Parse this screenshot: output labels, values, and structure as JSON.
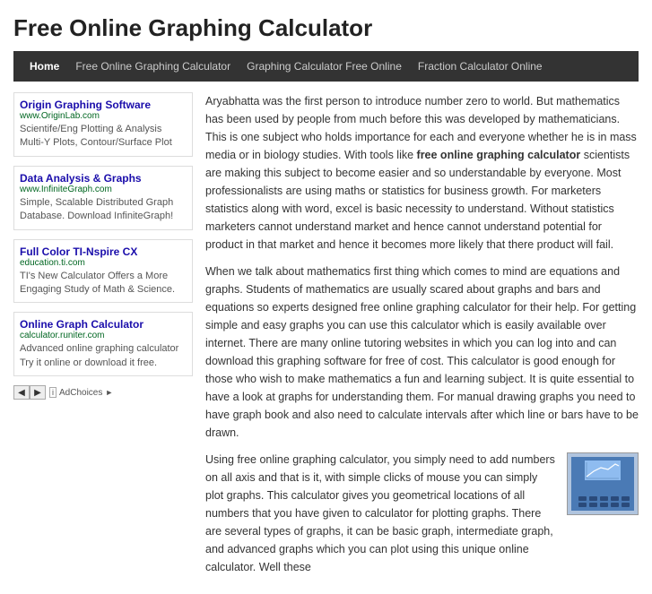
{
  "page": {
    "title": "Free Online Graphing Calculator"
  },
  "nav": {
    "items": [
      {
        "label": "Home",
        "active": true
      },
      {
        "label": "Free Online Graphing Calculator",
        "active": false
      },
      {
        "label": "Graphing Calculator Free Online",
        "active": false
      },
      {
        "label": "Fraction Calculator Online",
        "active": false
      }
    ]
  },
  "sidebar": {
    "ads": [
      {
        "title": "Origin Graphing Software",
        "url": "www.OriginLab.com",
        "description": "Scientife/Eng Plotting & Analysis Multi-Y Plots, Contour/Surface Plot"
      },
      {
        "title": "Data Analysis & Graphs",
        "url": "www.InfiniteGraph.com",
        "description": "Simple, Scalable Distributed Graph Database. Download InfiniteGraph!"
      },
      {
        "title": "Full Color TI-Nspire CX",
        "url": "education.ti.com",
        "description": "TI's New Calculator Offers a More Engaging Study of Math & Science."
      },
      {
        "title": "Online Graph Calculator",
        "url": "calculator.runiter.com",
        "description": "Advanced online graphing calculator Try it online or download it free."
      }
    ],
    "adchoices_label": "AdChoices"
  },
  "content": {
    "paragraph1": "Aryabhatta was the first person to introduce number zero to world. But mathematics has been used by people from much before this was developed by mathematicians. This is one subject who holds importance for each and everyone whether he is in mass media or in biology studies. With tools like ",
    "paragraph1_bold": "free online graphing calculator",
    "paragraph1_cont": " scientists are making this subject to become easier and so understandable by everyone. Most professionalists are using maths or statistics for business growth. For marketers statistics along with word, excel is basic necessity to understand. Without statistics marketers cannot understand market and hence cannot understand potential for product in that market and hence it becomes more likely that there product will fail.",
    "paragraph2_start": "When we talk about mathematics first thing which comes to mind are equations and graphs. Students of mathematics are usually scared about graphs and bars and equations so experts designed ",
    "paragraph2_bold": "free online graphing calculator",
    "paragraph2_cont": " for their help. For getting simple and easy graphs you can use this calculator which is easily available over internet. There are many online tutoring websites in which you can log into and can download this graphing software for free of cost. This calculator is good enough for those who wish to make mathematics a fun and learning subject. It is quite essential to have a look at graphs for understanding them. For manual drawing graphs you need to have graph book and also need to calculate intervals after which line or bars have to be drawn.",
    "paragraph3_start": "Using ",
    "paragraph3_bold": "free online graphing calculator,",
    "paragraph3_cont": " you simply need to add numbers on all axis and that is it, with simple clicks of mouse you can simply plot graphs. This calculator gives you geometrical locations of all numbers that you have given to calculator for plotting graphs. There are several types of graphs, it can be basic graph, intermediate graph, and advanced graphs which you can plot using this unique online calculator. Well these"
  }
}
